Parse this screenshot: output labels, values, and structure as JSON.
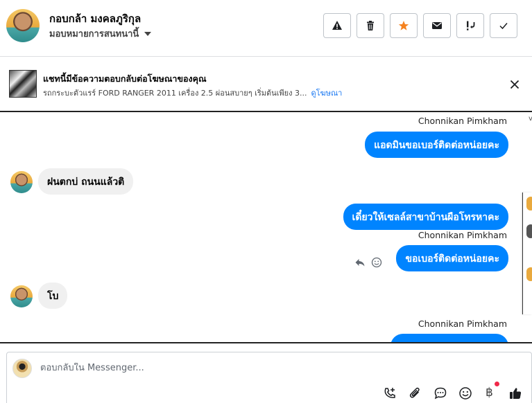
{
  "header": {
    "contact_name": "กอบกล้า มงคลภูริกุล",
    "assign_label": "มอบหมายการสนทนานี้",
    "icons": [
      "warning-icon",
      "trash-icon",
      "star-icon",
      "mail-icon",
      "mark-important-icon",
      "check-icon"
    ],
    "star_color": "#f5821f"
  },
  "ad": {
    "title": "แชทนี้มีข้อความตอบกลับต่อโฆษณาของคุณ",
    "description": "รถกระบะตัวแรร์ FORD RANGER 2011 เครื่อง 2.5 ผ่อนสบายๆ เริ่มต้นเพียง 3...",
    "link": "ดูโฆษณา"
  },
  "conversation": {
    "messages": [
      {
        "direction": "out",
        "sender": "Chonnikan Pimkham",
        "text": "แอดมินขอเบอร์ติดต่อหน่อยคะ"
      },
      {
        "direction": "in",
        "text": "ฝนตกบ่ ถนนแล้วติ"
      },
      {
        "direction": "out",
        "text": "เดี๋ยวให้เซลล์สาขาบ้านผือโทรหาคะ"
      },
      {
        "direction": "out",
        "sender": "Chonnikan Pimkham",
        "text": "ขอเบอร์ติดต่อหน่อยคะ"
      },
      {
        "direction": "in",
        "text": "โบ"
      },
      {
        "direction": "out",
        "sender": "Chonnikan Pimkham",
        "text": ""
      }
    ],
    "outgoing_color": "#0084ff",
    "incoming_color": "#f0f0f0"
  },
  "composer": {
    "placeholder": "ตอบกลับใน Messenger...",
    "currency_symbol": "฿",
    "icons": [
      "add-call-icon",
      "attachment-icon",
      "saved-reply-icon",
      "emoji-icon",
      "payment-icon",
      "like-icon"
    ]
  },
  "side": {
    "cut_mark": "v"
  }
}
